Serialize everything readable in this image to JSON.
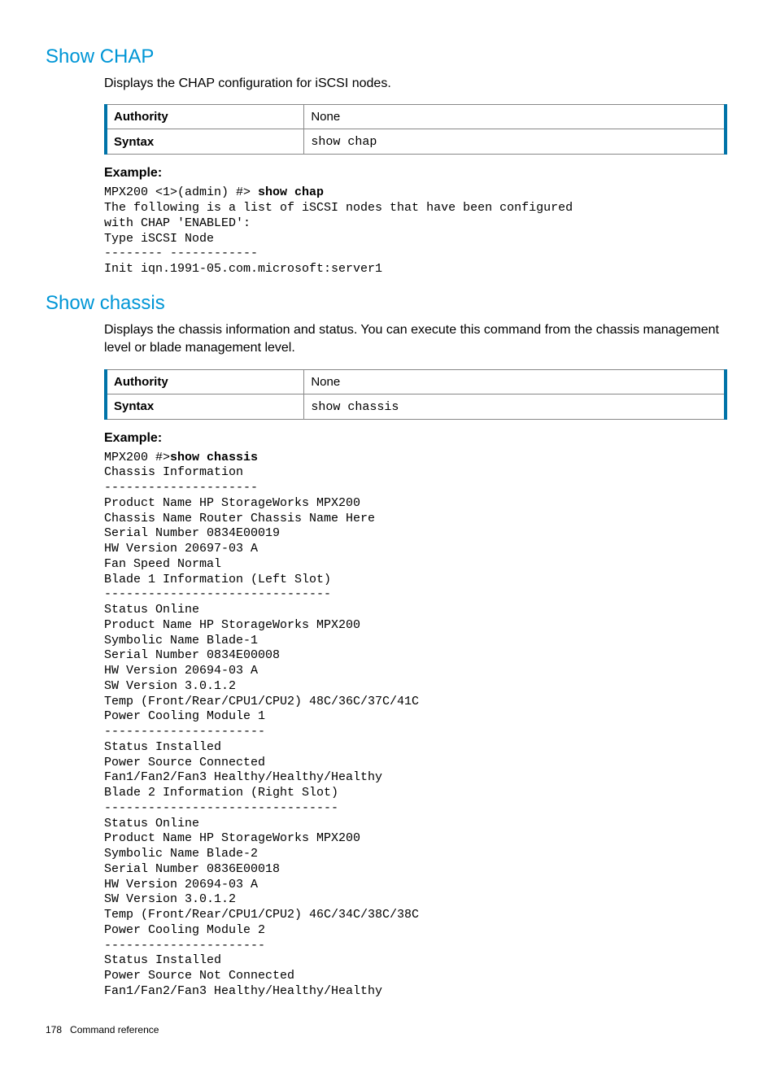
{
  "section1": {
    "heading": "Show CHAP",
    "description": "Displays the CHAP configuration for iSCSI nodes.",
    "table": {
      "authority_label": "Authority",
      "authority_value": "None",
      "syntax_label": "Syntax",
      "syntax_value": "show chap"
    },
    "example_label": "Example:",
    "example_prompt_prefix": "MPX200 <1>(admin) #> ",
    "example_command": "show chap",
    "example_body": "The following is a list of iSCSI nodes that have been configured\nwith CHAP 'ENABLED':\nType iSCSI Node\n-------- ------------\nInit iqn.1991-05.com.microsoft:server1"
  },
  "section2": {
    "heading": "Show chassis",
    "description": "Displays the chassis information and status. You can execute this command from the chassis management level or blade management level.",
    "table": {
      "authority_label": "Authority",
      "authority_value": "None",
      "syntax_label": "Syntax",
      "syntax_value": "show chassis"
    },
    "example_label": "Example:",
    "example_prompt_prefix": "MPX200 #>",
    "example_command": "show chassis",
    "example_body": "Chassis Information\n---------------------\nProduct Name HP StorageWorks MPX200\nChassis Name Router Chassis Name Here\nSerial Number 0834E00019\nHW Version 20697-03 A\nFan Speed Normal\nBlade 1 Information (Left Slot)\n-------------------------------\nStatus Online\nProduct Name HP StorageWorks MPX200\nSymbolic Name Blade-1\nSerial Number 0834E00008\nHW Version 20694-03 A\nSW Version 3.0.1.2\nTemp (Front/Rear/CPU1/CPU2) 48C/36C/37C/41C\nPower Cooling Module 1\n----------------------\nStatus Installed\nPower Source Connected\nFan1/Fan2/Fan3 Healthy/Healthy/Healthy\nBlade 2 Information (Right Slot)\n--------------------------------\nStatus Online\nProduct Name HP StorageWorks MPX200\nSymbolic Name Blade-2\nSerial Number 0836E00018\nHW Version 20694-03 A\nSW Version 3.0.1.2\nTemp (Front/Rear/CPU1/CPU2) 46C/34C/38C/38C\nPower Cooling Module 2\n----------------------\nStatus Installed\nPower Source Not Connected\nFan1/Fan2/Fan3 Healthy/Healthy/Healthy"
  },
  "footer": {
    "page_number": "178",
    "title": "Command reference"
  }
}
